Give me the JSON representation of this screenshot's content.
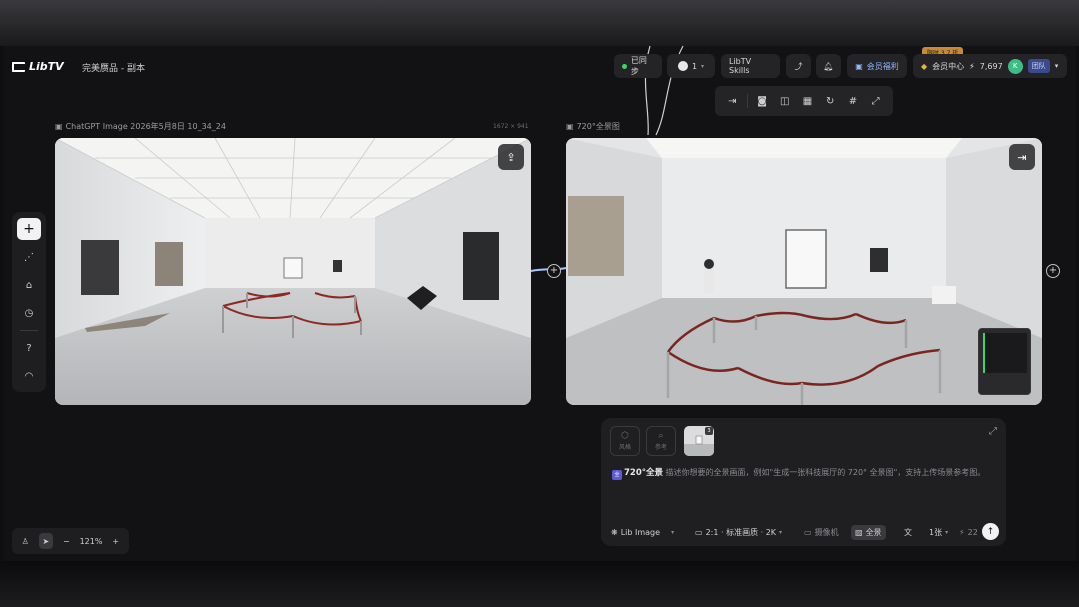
{
  "app": {
    "logo_text": "LibTV",
    "project_name": "完美赝品 - 副本"
  },
  "header": {
    "sync_label": "已同步",
    "users_count": "1",
    "skills_label": "LibTV Skills",
    "membership_label": "会员福利",
    "vip_badge": "限时 3.7 折",
    "vip_center_label": "会员中心",
    "credits": "7,697",
    "avatar_initial": "K",
    "team_label": "团队"
  },
  "toolbar": {
    "items": [
      "exit-icon",
      "camera-icon",
      "split-icon",
      "grid-icon",
      "refresh-icon",
      "crop-icon",
      "expand-icon"
    ]
  },
  "left_image": {
    "title": "ChatGPT Image 2026年5月8日 10_34_24",
    "dims": "1672 × 941"
  },
  "right_image": {
    "title": "720°全景图"
  },
  "sidebar": {
    "items": [
      "plus-icon",
      "share-nodes-icon",
      "assets-icon",
      "history-icon",
      "help-icon",
      "support-icon"
    ]
  },
  "zoom": {
    "level": "121%"
  },
  "prompt": {
    "ref_slot_1": "风格",
    "ref_slot_2": "参考",
    "thumb_badge": "3",
    "mode_tag": "720°全景",
    "placeholder": "描述你想要的全景画面，例如\"生成一张科技展厅的 720° 全景图\"，支持上传场景参考图。",
    "model": "Lib Image",
    "ratio": "2:1 · 标准画质 · 2K",
    "camera": "摄像机",
    "panorama": "全景",
    "count": "1张",
    "credits_cost": "22"
  },
  "colors": {
    "accent_green": "#3ad66b",
    "vip_orange": "#c8893a",
    "team_blue": "#3a4a8a",
    "panel": "#1f1f22"
  }
}
